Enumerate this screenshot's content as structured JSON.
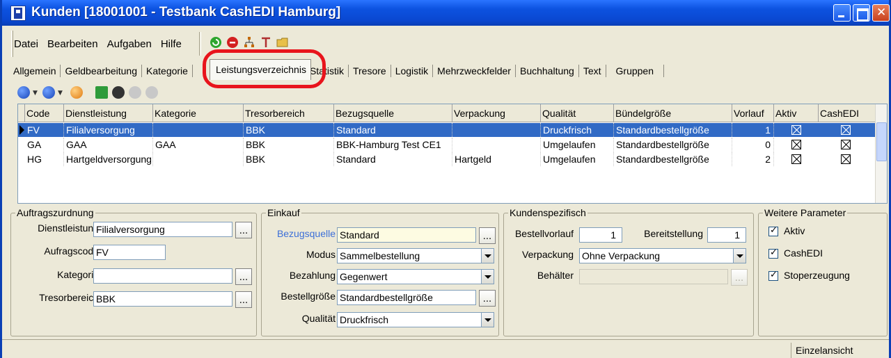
{
  "window": {
    "title": "Kunden [18001001 - Testbank CashEDI Hamburg]"
  },
  "menu": [
    "Datei",
    "Bearbeiten",
    "Aufgaben",
    "Hilfe"
  ],
  "toolbar_icons": [
    "refresh-icon",
    "stop-icon",
    "tree-icon",
    "text-icon",
    "folder-icon"
  ],
  "tabs": [
    "Allgemein",
    "Geldbearbeitung",
    "Kategorie",
    "Leistungsverzeichnis",
    "Statistik",
    "Tresore",
    "Logistik",
    "Mehrzweckfelder",
    "Buchhaltung",
    "Text",
    "Gruppen"
  ],
  "active_tab": "Leistungsverzeichnis",
  "grid": {
    "columns": [
      "Code",
      "Dienstleistung",
      "Kategorie",
      "Tresorbereich",
      "Bezugsquelle",
      "Verpackung",
      "Qualität",
      "Bündelgröße",
      "Vorlauf",
      "Aktiv",
      "CashEDI"
    ],
    "rows": [
      {
        "code": "FV",
        "dienstleistung": "Filialversorgung",
        "kategorie": "",
        "tresorbereich": "BBK",
        "bezugsquelle": "Standard",
        "verpackung": "",
        "qualitaet": "Druckfrisch",
        "buendelgroesse": "Standardbestellgröße",
        "vorlauf": "1",
        "aktiv": true,
        "cashedi": true,
        "selected": true
      },
      {
        "code": "GA",
        "dienstleistung": "GAA",
        "kategorie": "GAA",
        "tresorbereich": "BBK",
        "bezugsquelle": "BBK-Hamburg Test CE1",
        "verpackung": "",
        "qualitaet": "Umgelaufen",
        "buendelgroesse": "Standardbestellgröße",
        "vorlauf": "0",
        "aktiv": true,
        "cashedi": true,
        "selected": false
      },
      {
        "code": "HG",
        "dienstleistung": "Hartgeldversorgung",
        "kategorie": "",
        "tresorbereich": "BBK",
        "bezugsquelle": "Standard",
        "verpackung": "Hartgeld",
        "qualitaet": "Umgelaufen",
        "buendelgroesse": "Standardbestellgröße",
        "vorlauf": "2",
        "aktiv": true,
        "cashedi": true,
        "selected": false
      }
    ]
  },
  "auftragszuordnung": {
    "title": "Auftragszurdnung",
    "dienstleistung_label": "Dienstleistung",
    "dienstleistung_value": "Filialversorgung",
    "auftragscode_label": "Aufragscode",
    "auftragscode_value": "FV",
    "kategorie_label": "Kategorie",
    "kategorie_value": "",
    "tresorbereich_label": "Tresorbereich",
    "tresorbereich_value": "BBK"
  },
  "einkauf": {
    "title": "Einkauf",
    "bezugsquelle_label": "Bezugsquelle",
    "bezugsquelle_value": "Standard",
    "modus_label": "Modus",
    "modus_value": "Sammelbestellung",
    "bezahlung_label": "Bezahlung",
    "bezahlung_value": "Gegenwert",
    "bestellgroesse_label": "Bestellgröße",
    "bestellgroesse_value": "Standardbestellgröße",
    "qualitaet_label": "Qualität",
    "qualitaet_value": "Druckfrisch"
  },
  "kundenspezifisch": {
    "title": "Kundenspezifisch",
    "bestellvorlauf_label": "Bestellvorlauf",
    "bestellvorlauf_value": "1",
    "bereitstellung_label": "Bereitstellung",
    "bereitstellung_value": "1",
    "verpackung_label": "Verpackung",
    "verpackung_value": "Ohne Verpackung",
    "behaelter_label": "Behälter",
    "behaelter_value": ""
  },
  "weitere_parameter": {
    "title": "Weitere Parameter",
    "aktiv_label": "Aktiv",
    "aktiv_checked": true,
    "cashedi_label": "CashEDI",
    "cashedi_checked": true,
    "stoperzeugung_label": "Stoperzeugung",
    "stoperzeugung_checked": true
  },
  "status": {
    "view_mode": "Einzelansicht"
  },
  "colors": {
    "selection": "#316ac5",
    "highlight_ring": "#e8141c",
    "titlebar": "#0a47d0",
    "bezugsquelle_link": "#3c6fd8"
  }
}
